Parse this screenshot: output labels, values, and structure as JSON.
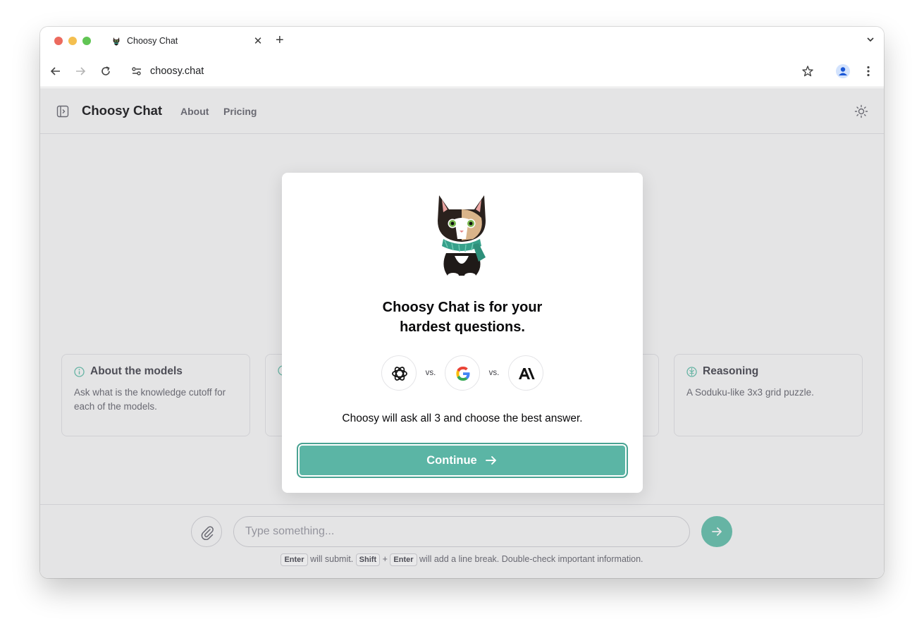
{
  "browser": {
    "tab_title": "Choosy Chat",
    "tab_close_glyph": "✕",
    "new_tab_glyph": "+",
    "url": "choosy.chat"
  },
  "app": {
    "brand": "Choosy Chat",
    "nav": [
      "About",
      "Pricing"
    ],
    "cards": [
      {
        "title": "About the models",
        "desc": "Ask what is the knowledge cutoff for each of the models."
      },
      {
        "title": "",
        "desc": ""
      },
      {
        "title": "",
        "desc": ""
      },
      {
        "title": "Reasoning",
        "desc": "A Soduku-like 3x3 grid puzzle."
      }
    ],
    "input_placeholder": "Type something...",
    "hint": {
      "key_enter": "Enter",
      "will_submit": "will submit.",
      "key_shift": "Shift",
      "plus": "+",
      "key_enter2": "Enter",
      "rest": "will add a line break. Double-check important information."
    }
  },
  "modal": {
    "headline_line1": "Choosy Chat is for your",
    "headline_line2": "hardest questions.",
    "vs1": "vs.",
    "vs2": "vs.",
    "providers": [
      "openai-icon",
      "google-icon",
      "anthropic-icon"
    ],
    "subtitle": "Choosy will ask all 3 and choose the best answer.",
    "continue_label": "Continue"
  },
  "colors": {
    "accent": "#5bb5a5",
    "send_button": "#6ec4b1"
  }
}
